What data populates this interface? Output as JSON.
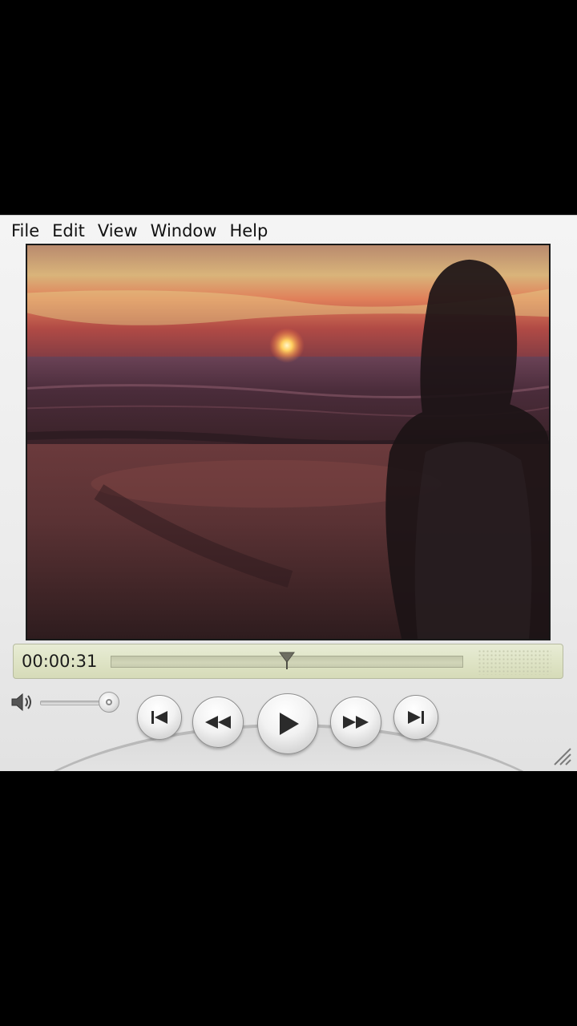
{
  "menu": {
    "items": [
      "File",
      "Edit",
      "View",
      "Window",
      "Help"
    ]
  },
  "playback": {
    "time": "00:00:31",
    "progress": 0.5,
    "volume": 1.0
  },
  "controls": {
    "icons": [
      "skip-back-icon",
      "rewind-icon",
      "play-icon",
      "fast-forward-icon",
      "skip-forward-icon"
    ]
  },
  "colors": {
    "lcd": "#dfe4c6",
    "chrome": "#ececec"
  }
}
